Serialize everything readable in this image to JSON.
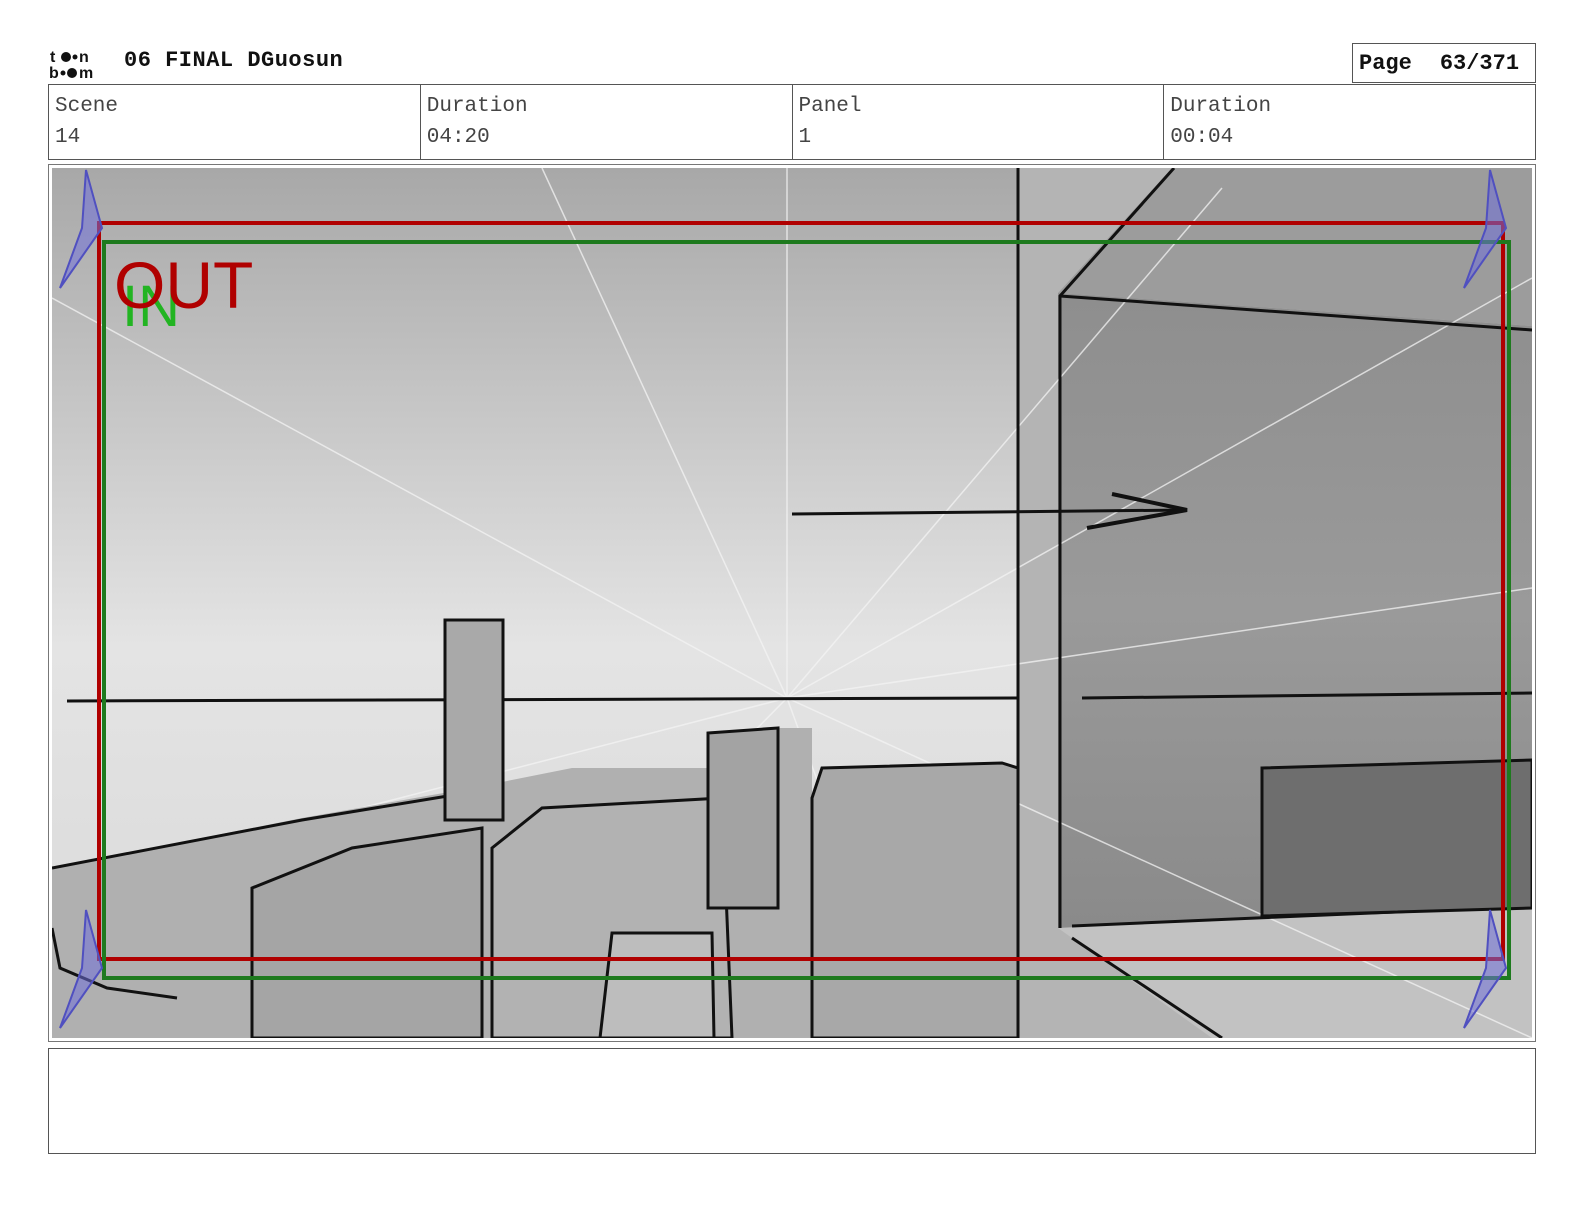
{
  "header": {
    "logo": {
      "icon": "toon-boom-logo",
      "text": "toon boom"
    },
    "title": "06 FINAL DGuosun",
    "page_label": "Page",
    "page_number": "63/371"
  },
  "info": {
    "scene_label": "Scene",
    "scene_value": "14",
    "scene_duration_label": "Duration",
    "scene_duration_value": "04:20",
    "panel_label": "Panel",
    "panel_value": "1",
    "panel_duration_label": "Duration",
    "panel_duration_value": "00:04"
  },
  "panel": {
    "frame_out_label": "OUT",
    "frame_in_label": "IN",
    "out_color": "#b00000",
    "in_color": "#1e7a1e",
    "in_text_color": "#22b422",
    "camera_marker_color": "#6a6ad0"
  },
  "notes": {
    "text": ""
  }
}
